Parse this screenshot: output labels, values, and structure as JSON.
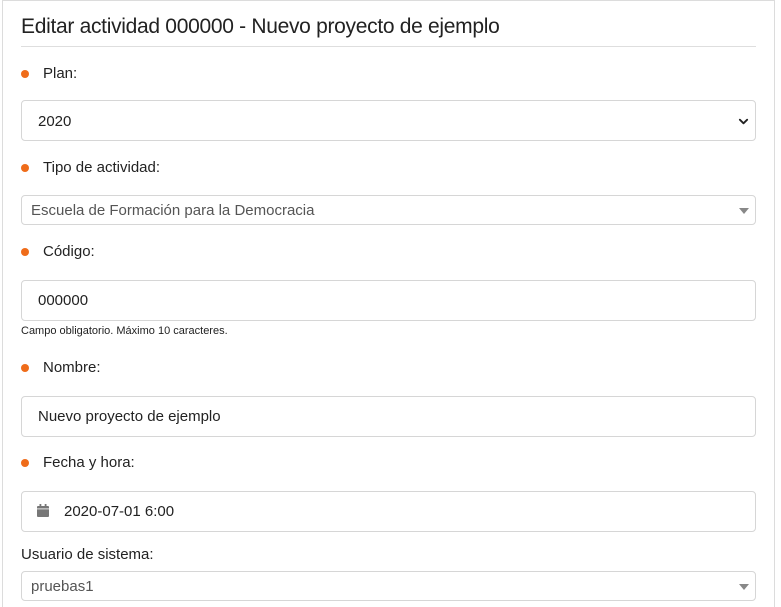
{
  "title": "Editar actividad 000000 - Nuevo proyecto de ejemplo",
  "fields": {
    "plan": {
      "label": "Plan:",
      "value": "2020"
    },
    "tipo": {
      "label": "Tipo de actividad:",
      "value": "Escuela de Formación para la Democracia"
    },
    "codigo": {
      "label": "Código:",
      "value": "000000",
      "help": "Campo obligatorio. Máximo 10 caracteres."
    },
    "nombre": {
      "label": "Nombre:",
      "value": "Nuevo proyecto de ejemplo"
    },
    "fecha": {
      "label": "Fecha y hora:",
      "value": "2020-07-01 6:00"
    },
    "usuario": {
      "label": "Usuario de sistema:",
      "value": "pruebas1"
    }
  },
  "colors": {
    "required_dot": "#ef6c1a"
  },
  "icons": [
    "calendar-icon",
    "chevron-down-icon",
    "caret-down-icon"
  ]
}
